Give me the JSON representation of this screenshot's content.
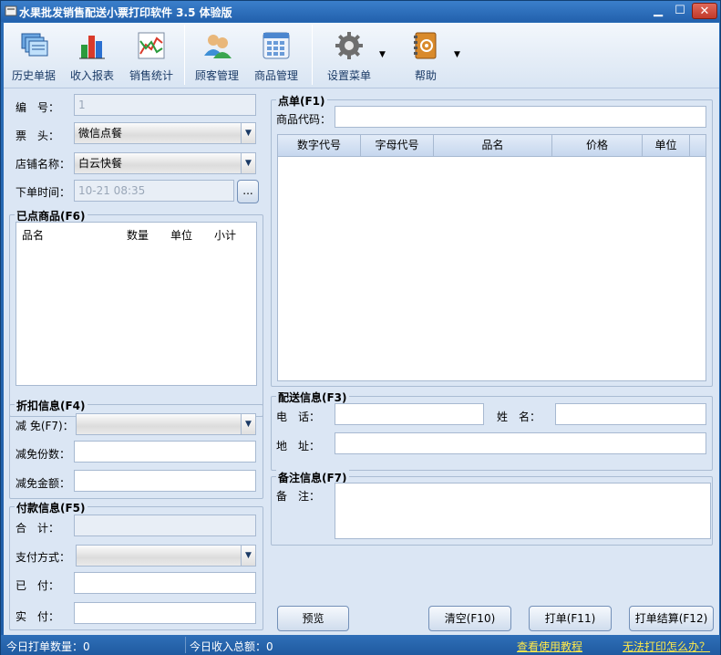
{
  "window": {
    "title": "水果批发销售配送小票打印软件 3.5 体验版"
  },
  "toolbar": {
    "items": [
      {
        "label": "历史单据",
        "icon": "history-icon"
      },
      {
        "label": "收入报表",
        "icon": "bar-chart-icon"
      },
      {
        "label": "销售统计",
        "icon": "line-chart-icon"
      },
      {
        "label": "顾客管理",
        "icon": "users-icon"
      },
      {
        "label": "商品管理",
        "icon": "grid-icon"
      },
      {
        "label": "设置菜单",
        "icon": "gear-icon"
      },
      {
        "label": "帮助",
        "icon": "help-book-icon"
      }
    ]
  },
  "form": {
    "number_label": "编　号：",
    "number_value": "1",
    "ticket_label": "票　头：",
    "ticket_value": "微信点餐",
    "store_label": "店铺名称：",
    "store_value": "白云快餐",
    "time_label": "下单时间：",
    "time_value": "10-21 08:35",
    "time_button": "..."
  },
  "ordered": {
    "title": "已点商品(F6)",
    "columns": [
      "品名",
      "数量",
      "单位",
      "小计"
    ]
  },
  "discount": {
    "title": "折扣信息(F4)",
    "reduce_label": "减 免(F7)：",
    "copies_label": "减免份数：",
    "amount_label": "减免金额："
  },
  "payment": {
    "title": "付款信息(F5)",
    "total_label": "合　计：",
    "method_label": "支付方式：",
    "paid_label": "已　付：",
    "actual_label": "实　付："
  },
  "order": {
    "title": "点单(F1)",
    "code_label": "商品代码：",
    "columns": [
      "数字代号",
      "字母代号",
      "品名",
      "价格",
      "单位"
    ]
  },
  "delivery": {
    "title": "配送信息(F3)",
    "phone_label": "电　话：",
    "name_label": "姓　名：",
    "address_label": "地　址："
  },
  "notes": {
    "title": "备注信息(F7)",
    "label": "备　注："
  },
  "buttons": {
    "preview": "预览",
    "clear": "清空(F10)",
    "print": "打单(F11)",
    "print_settle": "打单结算(F12)"
  },
  "status": {
    "orders_today": "今日打单数量：0",
    "income_today": "今日收入总额：0",
    "tutorial_link": "查看使用教程",
    "print_help_link": "无法打印怎么办？"
  },
  "colors": {
    "accent": "#2261ad",
    "panel": "#dbe6f4",
    "link": "#ffe94a"
  }
}
